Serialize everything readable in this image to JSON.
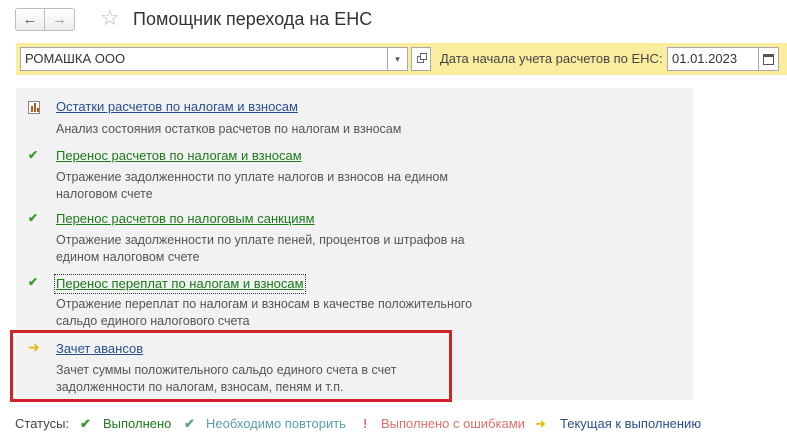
{
  "header": {
    "back_glyph": "←",
    "forward_glyph": "→",
    "star_glyph": "☆",
    "title": "Помощник перехода на ЕНС"
  },
  "filter": {
    "organization": "РОМАШКА ООО",
    "dropdown_glyph": "▾",
    "date_label": "Дата начала учета расчетов по ЕНС:",
    "date_value": "01.01.2023"
  },
  "steps": [
    {
      "status": "report",
      "link": "Остатки расчетов по налогам и взносам",
      "desc": "Анализ состояния остатков расчетов по налогам и взносам"
    },
    {
      "status": "done",
      "icon_glyph": "✔",
      "link": "Перенос расчетов по налогам и взносам",
      "desc": "Отражение задолженности по уплате налогов и взносов на едином налоговом счете"
    },
    {
      "status": "done",
      "icon_glyph": "✔",
      "link": "Перенос расчетов по налоговым санкциям",
      "desc": "Отражение задолженности по уплате пеней, процентов и штрафов на едином налоговом счете"
    },
    {
      "status": "done",
      "icon_glyph": "✔",
      "link": "Перенос переплат по налогам и взносам",
      "desc": "Отражение переплат по налогам и взносам в качестве положительного сальдо единого налогового счета"
    },
    {
      "status": "current",
      "icon_glyph": "➜",
      "link": "Зачет авансов",
      "desc": "Зачет суммы положительного сальдо единого счета в счет задолженности по налогам, взносам, пеням и т.п."
    }
  ],
  "legend": {
    "label": "Статусы:",
    "done_glyph": "✔",
    "done": "Выполнено",
    "repeat_glyph": "✔",
    "repeat": "Необходимо повторить",
    "error_glyph": "!",
    "error": "Выполнено с ошибками",
    "current_glyph": "➜",
    "current": "Текущая к выполнению"
  },
  "colors": {
    "toolbar_bg": "#fbed9e",
    "panel_bg": "#f2f2f2",
    "highlight": "#d2232a",
    "done_green": "#1b7a1b",
    "repeat_teal": "#5aa0a0",
    "error_red": "#e0706c",
    "current_blue": "#2a4f8f",
    "current_arrow": "#e6b800"
  }
}
